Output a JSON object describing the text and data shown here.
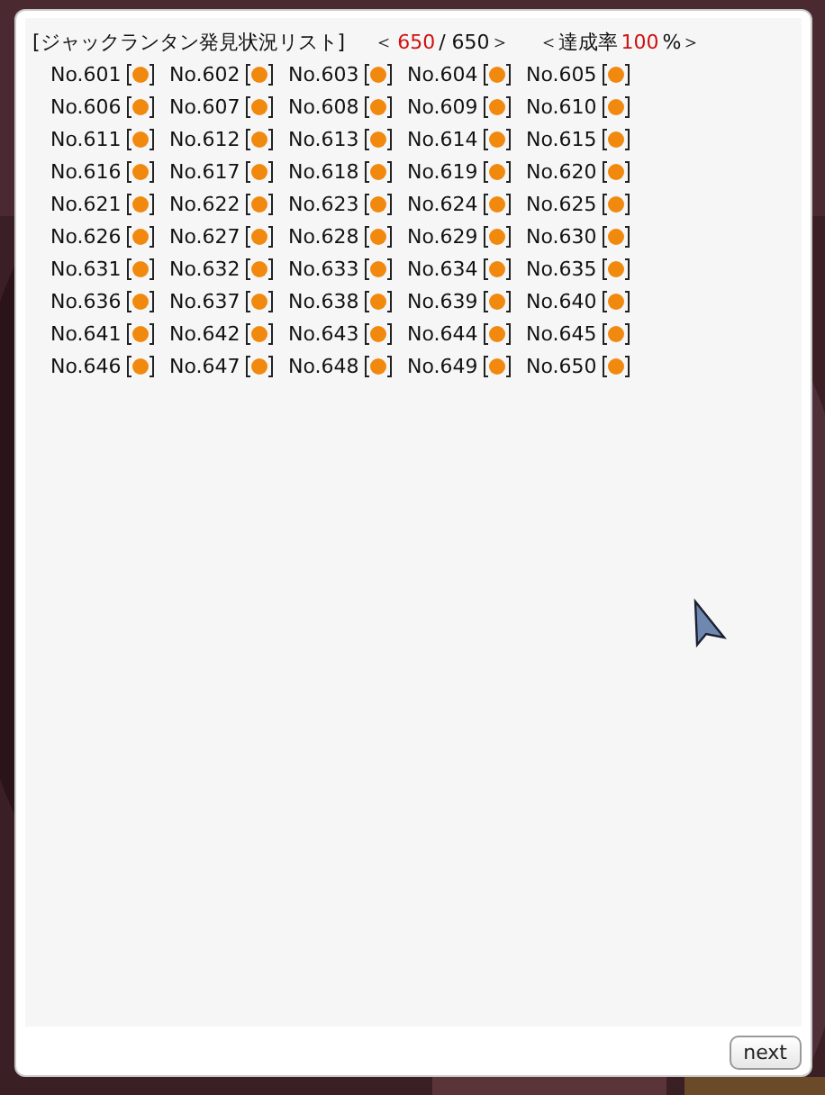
{
  "header": [
    {
      "text": "[ジャックランタン発見状況リスト]",
      "kind": "plain"
    },
    {
      "text": "＜",
      "kind": "plain"
    },
    {
      "text": "650",
      "kind": "highlight"
    },
    {
      "text": "/ 650＞",
      "kind": "plain"
    },
    {
      "text": "＜達成率",
      "kind": "plain"
    },
    {
      "text": "100",
      "kind": "highlight"
    },
    {
      "text": "%＞",
      "kind": "plain"
    }
  ],
  "entries": [
    {
      "number": "No.601",
      "found": true
    },
    {
      "number": "No.602",
      "found": true
    },
    {
      "number": "No.603",
      "found": true
    },
    {
      "number": "No.604",
      "found": true
    },
    {
      "number": "No.605",
      "found": true
    },
    {
      "number": "No.606",
      "found": true
    },
    {
      "number": "No.607",
      "found": true
    },
    {
      "number": "No.608",
      "found": true
    },
    {
      "number": "No.609",
      "found": true
    },
    {
      "number": "No.610",
      "found": true
    },
    {
      "number": "No.611",
      "found": true
    },
    {
      "number": "No.612",
      "found": true
    },
    {
      "number": "No.613",
      "found": true
    },
    {
      "number": "No.614",
      "found": true
    },
    {
      "number": "No.615",
      "found": true
    },
    {
      "number": "No.616",
      "found": true
    },
    {
      "number": "No.617",
      "found": true
    },
    {
      "number": "No.618",
      "found": true
    },
    {
      "number": "No.619",
      "found": true
    },
    {
      "number": "No.620",
      "found": true
    },
    {
      "number": "No.621",
      "found": true
    },
    {
      "number": "No.622",
      "found": true
    },
    {
      "number": "No.623",
      "found": true
    },
    {
      "number": "No.624",
      "found": true
    },
    {
      "number": "No.625",
      "found": true
    },
    {
      "number": "No.626",
      "found": true
    },
    {
      "number": "No.627",
      "found": true
    },
    {
      "number": "No.628",
      "found": true
    },
    {
      "number": "No.629",
      "found": true
    },
    {
      "number": "No.630",
      "found": true
    },
    {
      "number": "No.631",
      "found": true
    },
    {
      "number": "No.632",
      "found": true
    },
    {
      "number": "No.633",
      "found": true
    },
    {
      "number": "No.634",
      "found": true
    },
    {
      "number": "No.635",
      "found": true
    },
    {
      "number": "No.636",
      "found": true
    },
    {
      "number": "No.637",
      "found": true
    },
    {
      "number": "No.638",
      "found": true
    },
    {
      "number": "No.639",
      "found": true
    },
    {
      "number": "No.640",
      "found": true
    },
    {
      "number": "No.641",
      "found": true
    },
    {
      "number": "No.642",
      "found": true
    },
    {
      "number": "No.643",
      "found": true
    },
    {
      "number": "No.644",
      "found": true
    },
    {
      "number": "No.645",
      "found": true
    },
    {
      "number": "No.646",
      "found": true
    },
    {
      "number": "No.647",
      "found": true
    },
    {
      "number": "No.648",
      "found": true
    },
    {
      "number": "No.649",
      "found": true
    },
    {
      "number": "No.650",
      "found": true
    }
  ],
  "next_button": "next"
}
